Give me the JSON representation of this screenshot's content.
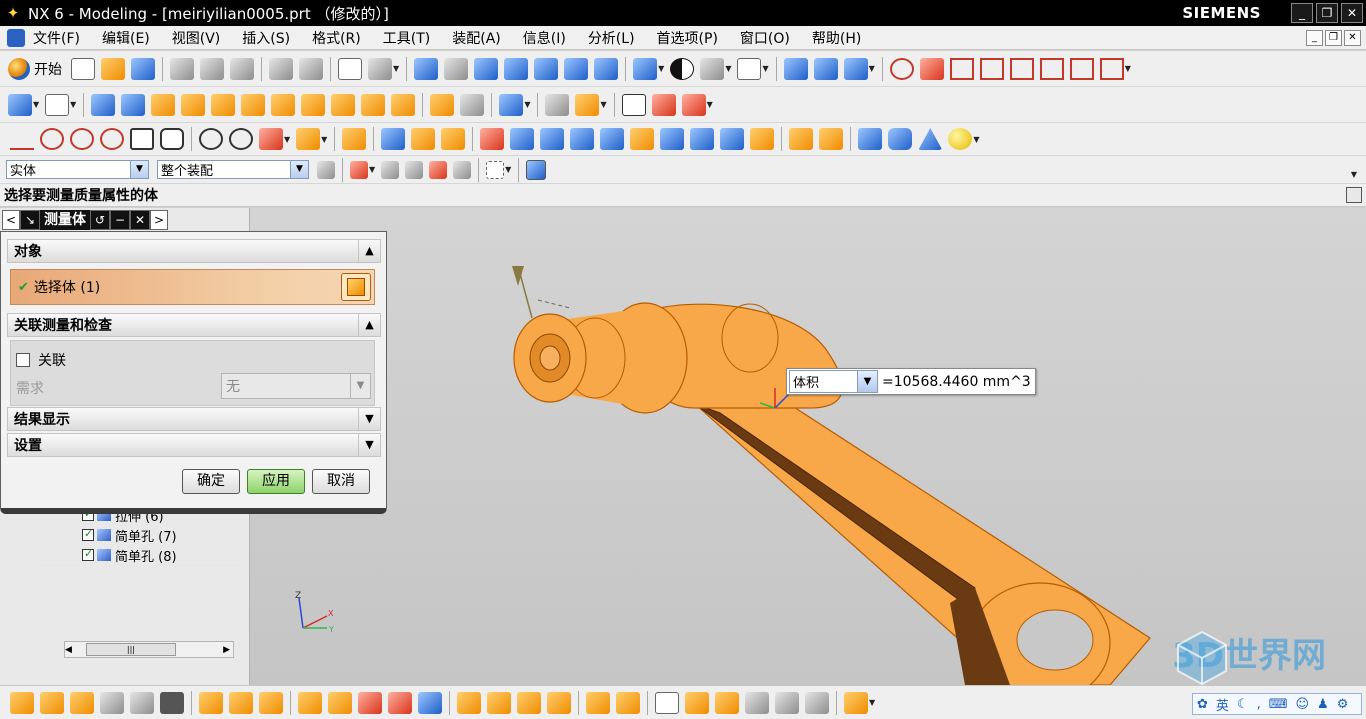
{
  "window": {
    "title": "NX 6 - Modeling - [meiriyilian0005.prt （修改的）]",
    "brand": "SIEMENS",
    "controls": [
      "_",
      "❐",
      "✕"
    ]
  },
  "menu": {
    "items": [
      "文件(F)",
      "编辑(E)",
      "视图(V)",
      "插入(S)",
      "格式(R)",
      "工具(T)",
      "装配(A)",
      "信息(I)",
      "分析(L)",
      "首选项(P)",
      "窗口(O)",
      "帮助(H)"
    ],
    "mdi_controls": [
      "_",
      "❐",
      "✕"
    ]
  },
  "toolbar": {
    "start_label": "开始",
    "type_filter": "实体",
    "scope_filter": "整个装配"
  },
  "cue": {
    "text": "选择要测量质量属性的体"
  },
  "dialog": {
    "title": "测量体",
    "header_buttons": [
      "<",
      "↘",
      "↺",
      "−",
      "✕",
      ">"
    ],
    "section_object": "对象",
    "select_body": "选择体 (1)",
    "section_assoc": "关联测量和检查",
    "assoc_checkbox": "关联",
    "requirement_label": "需求",
    "requirement_value": "无",
    "section_results": "结果显示",
    "section_settings": "设置",
    "ok": "确定",
    "apply": "应用",
    "cancel": "取消"
  },
  "navigator": {
    "rows": [
      {
        "label": "拉伸 (6)"
      },
      {
        "label": "简单孔 (7)"
      },
      {
        "label": "简单孔 (8)"
      }
    ]
  },
  "readout": {
    "measure_type": "体积",
    "value": "=10568.4460 mm^3"
  },
  "axes": {
    "z": "Z",
    "x": "X",
    "y": "Y"
  },
  "watermark": {
    "text": "3D世界网"
  },
  "ime": {
    "lang": "英"
  },
  "colors": {
    "part": "#f8a848",
    "part_edge": "#b85c00",
    "titlebar": "#000000",
    "apply_button": "#8dd369"
  }
}
